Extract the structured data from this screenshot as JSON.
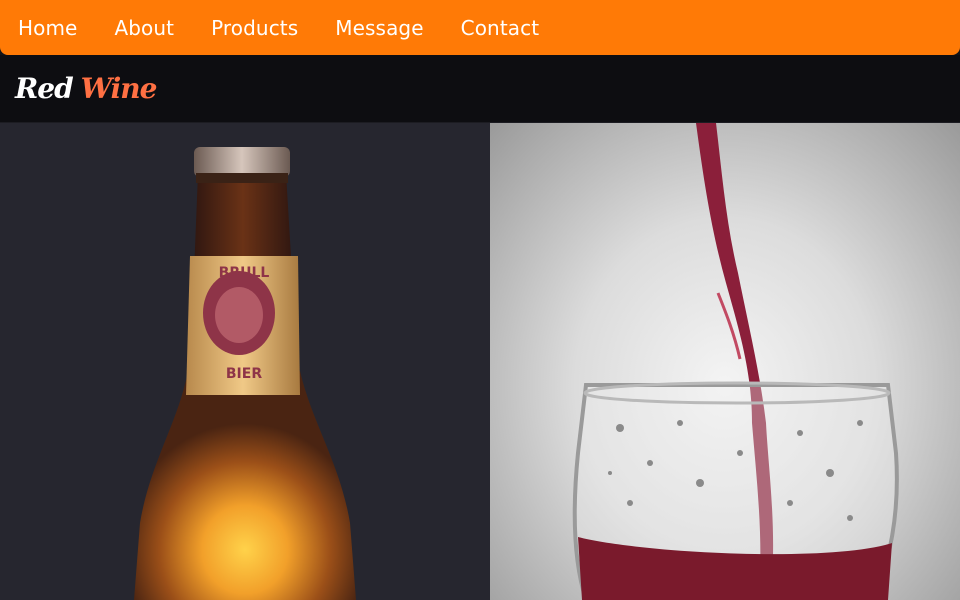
{
  "nav": {
    "items": [
      {
        "label": "Home"
      },
      {
        "label": "About"
      },
      {
        "label": "Products"
      },
      {
        "label": "Message"
      },
      {
        "label": "Contact"
      }
    ],
    "bg_color": "#ff7a06"
  },
  "brand": {
    "word1": "Red",
    "word2": "Wine",
    "accent_color": "#ff7043"
  },
  "hero": {
    "left_image": "beer-bottle-image",
    "right_image": "wine-pouring-glass-image"
  }
}
